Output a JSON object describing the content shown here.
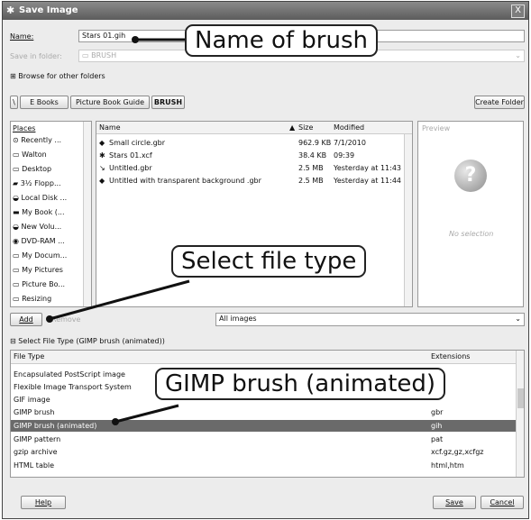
{
  "window": {
    "title": "Save Image",
    "close_label": "X"
  },
  "name_row": {
    "label": "Name:",
    "value": "Stars 01.gih"
  },
  "folder_row": {
    "label": "Save in folder:",
    "value": "BRUSH"
  },
  "browse_label": "Browse for other folders",
  "path_buttons": [
    "E Books",
    "Picture Book Guide",
    "BRUSH"
  ],
  "create_folder_label": "Create Folder",
  "places": {
    "header": "Places",
    "items": [
      "Recently ...",
      "Walton",
      "Desktop",
      "3½ Flopp...",
      "Local Disk ...",
      "My Book (...",
      "New Volu...",
      "DVD-RAM ...",
      "My Docum...",
      "My Pictures",
      "Picture Bo...",
      "Resizing"
    ]
  },
  "files": {
    "columns": {
      "name": "Name",
      "size": "Size",
      "modified": "Modified"
    },
    "rows": [
      {
        "name": "Small circle.gbr",
        "size": "962.9 KB",
        "modified": "7/1/2010"
      },
      {
        "name": "Stars 01.xcf",
        "size": "38.4 KB",
        "modified": "09:39"
      },
      {
        "name": "Untitled.gbr",
        "size": "2.5 MB",
        "modified": "Yesterday at 11:43"
      },
      {
        "name": "Untitled with transparent background .gbr",
        "size": "2.5 MB",
        "modified": "Yesterday at 11:44"
      }
    ]
  },
  "preview": {
    "header": "Preview",
    "no_selection": "No selection"
  },
  "add_label": "Add",
  "remove_label": "Remove",
  "filter_value": "All images",
  "file_type_toggle": "Select File Type (GIMP brush (animated))",
  "file_types": {
    "columns": {
      "type": "File Type",
      "ext": "Extensions"
    },
    "rows": [
      {
        "type": "Encapsulated PostScript image",
        "ext": ""
      },
      {
        "type": "Flexible Image Transport System",
        "ext": ""
      },
      {
        "type": "GIF image",
        "ext": ""
      },
      {
        "type": "GIMP brush",
        "ext": "gbr"
      },
      {
        "type": "GIMP brush (animated)",
        "ext": "gih",
        "selected": true
      },
      {
        "type": "GIMP pattern",
        "ext": "pat"
      },
      {
        "type": "gzip archive",
        "ext": "xcf.gz,gz,xcfgz"
      },
      {
        "type": "HTML table",
        "ext": "html,htm"
      }
    ]
  },
  "buttons": {
    "help": "Help",
    "save": "Save",
    "cancel": "Cancel"
  },
  "callouts": {
    "name": "Name of brush",
    "type": "Select file type",
    "gimp": "GIMP brush (animated)"
  }
}
